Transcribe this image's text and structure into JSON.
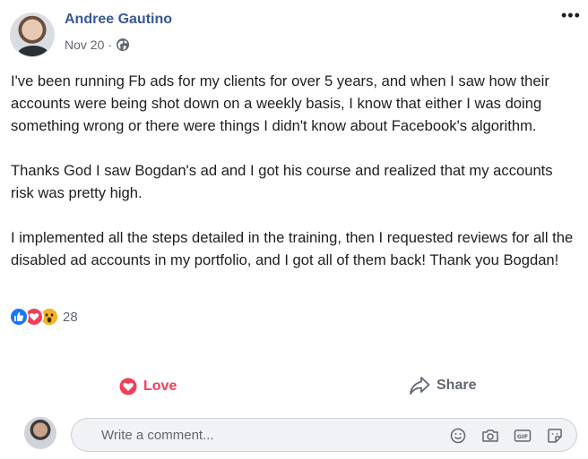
{
  "post": {
    "author": "Andree Gautino",
    "date": "Nov 20",
    "separator": "·",
    "privacy_icon": "globe-icon",
    "more_label": "•••",
    "paragraphs": [
      "I've been running Fb ads for my clients for over 5 years, and when I saw how their accounts were being shot down on a weekly basis, I know that either I was doing something wrong or there were things I didn't know about Facebook's algorithm.",
      "Thanks God I saw Bogdan's ad and I got his course and realized that my accounts risk was pretty high.",
      "I implemented all the steps detailed in the training, then I requested reviews for all the disabled ad accounts in my portfolio, and I got all of them back! Thank you Bogdan!"
    ],
    "reactions": {
      "types": [
        "like",
        "love",
        "wow"
      ],
      "count": "28"
    }
  },
  "actions": {
    "love_label": "Love",
    "share_label": "Share"
  },
  "comment": {
    "placeholder": "Write a comment...",
    "icons": [
      "emoji-icon",
      "camera-icon",
      "gif-icon",
      "sticker-icon"
    ]
  },
  "colors": {
    "author": "#385898",
    "love": "#f33e58",
    "like": "#1877f2",
    "wow": "#f7b125",
    "muted": "#606770"
  }
}
